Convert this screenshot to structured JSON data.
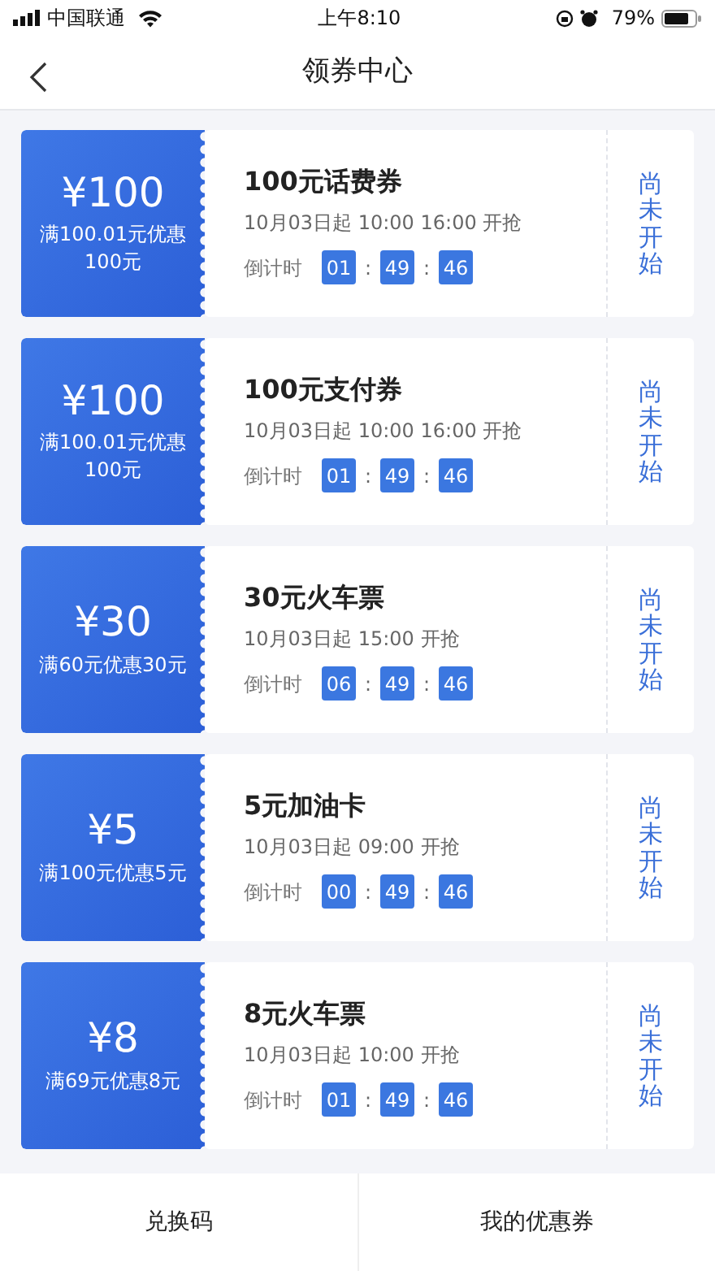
{
  "status_bar": {
    "carrier": "中国联通",
    "time": "上午8:10",
    "battery": "79%"
  },
  "nav": {
    "title": "领券中心"
  },
  "coupons": [
    {
      "amount": "¥100",
      "condition": "满100.01元优惠100元",
      "title": "100元话费券",
      "start": "10月03日起 10:00 16:00 开抢",
      "countdown_label": "倒计时",
      "countdown": [
        "01",
        ":",
        "49",
        ":",
        "46"
      ],
      "status": "尚未开始"
    },
    {
      "amount": "¥100",
      "condition": "满100.01元优惠100元",
      "title": "100元支付券",
      "start": "10月03日起 10:00 16:00 开抢",
      "countdown_label": "倒计时",
      "countdown": [
        "01",
        ":",
        "49",
        ":",
        "46"
      ],
      "status": "尚未开始"
    },
    {
      "amount": "¥30",
      "condition": "满60元优惠30元",
      "title": "30元火车票",
      "start": "10月03日起 15:00 开抢",
      "countdown_label": "倒计时",
      "countdown": [
        "06",
        ":",
        "49",
        ":",
        "46"
      ],
      "status": "尚未开始"
    },
    {
      "amount": "¥5",
      "condition": "满100元优惠5元",
      "title": "5元加油卡",
      "start": "10月03日起 09:00 开抢",
      "countdown_label": "倒计时",
      "countdown": [
        "00",
        ":",
        "49",
        ":",
        "46"
      ],
      "status": "尚未开始"
    },
    {
      "amount": "¥8",
      "condition": "满69元优惠8元",
      "title": "8元火车票",
      "start": "10月03日起 10:00 开抢",
      "countdown_label": "倒计时",
      "countdown": [
        "01",
        ":",
        "49",
        ":",
        "46"
      ],
      "status": "尚未开始"
    }
  ],
  "bottom_bar": [
    "兑换码",
    "我的优惠券"
  ]
}
